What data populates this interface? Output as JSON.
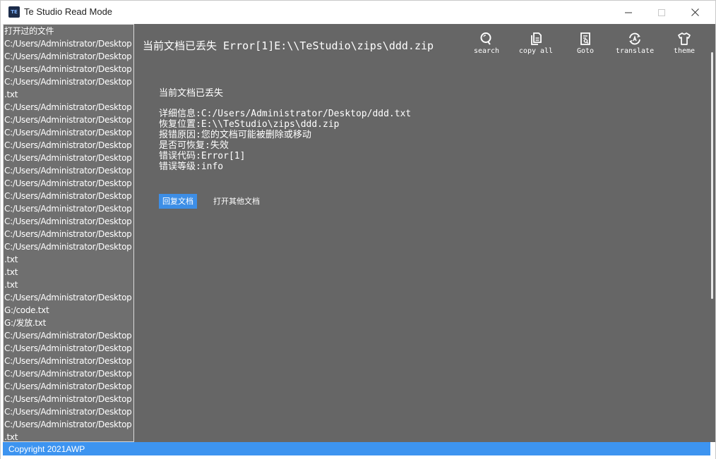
{
  "window": {
    "title": "Te Studio Read Mode",
    "icon_text": "TE"
  },
  "sidebar": {
    "header": "打开过的文件",
    "items": [
      "C:/Users/Administrator/Desktop",
      "C:/Users/Administrator/Desktop",
      "C:/Users/Administrator/Desktop",
      "C:/Users/Administrator/Desktop",
      ".txt",
      "C:/Users/Administrator/Desktop",
      "C:/Users/Administrator/Desktop",
      "C:/Users/Administrator/Desktop",
      "C:/Users/Administrator/Desktop",
      "C:/Users/Administrator/Desktop",
      "C:/Users/Administrator/Desktop",
      "C:/Users/Administrator/Desktop",
      "C:/Users/Administrator/Desktop",
      "C:/Users/Administrator/Desktop",
      "C:/Users/Administrator/Desktop",
      "C:/Users/Administrator/Desktop",
      "C:/Users/Administrator/Desktop",
      ".txt",
      ".txt",
      ".txt",
      "C:/Users/Administrator/Desktop",
      "G:/code.txt",
      "G:/发放.txt",
      "C:/Users/Administrator/Desktop",
      "C:/Users/Administrator/Desktop",
      "C:/Users/Administrator/Desktop",
      "C:/Users/Administrator/Desktop",
      "C:/Users/Administrator/Desktop",
      "C:/Users/Administrator/Desktop",
      "C:/Users/Administrator/Desktop",
      "C:/Users/Administrator/Desktop",
      ".txt"
    ]
  },
  "main": {
    "doc_title": "当前文档已丢失 Error[1]E:\\\\TeStudio\\zips\\ddd.zip",
    "message": {
      "heading": "当前文档已丢失",
      "lines": [
        "详细信息:C:/Users/Administrator/Desktop/ddd.txt",
        "恢复位置:E:\\\\TeStudio\\zips\\ddd.zip",
        "报错原因:您的文档可能被删除或移动",
        "是否可恢复:失效",
        "错误代码:Error[1]",
        "错误等级:info"
      ]
    },
    "buttons": {
      "recover": "回复文档",
      "open_other": "打开其他文档"
    }
  },
  "toolbar": {
    "search": "search",
    "copy_all": "copy all",
    "goto": "Goto",
    "translate": "translate",
    "theme": "theme"
  },
  "statusbar": {
    "text": "Copyright 2021AWP"
  },
  "colors": {
    "main_bg": "#666666",
    "sidebar_bg": "#6f6f6f",
    "accent": "#3d94f0",
    "primary_button": "#3d8ee6"
  }
}
